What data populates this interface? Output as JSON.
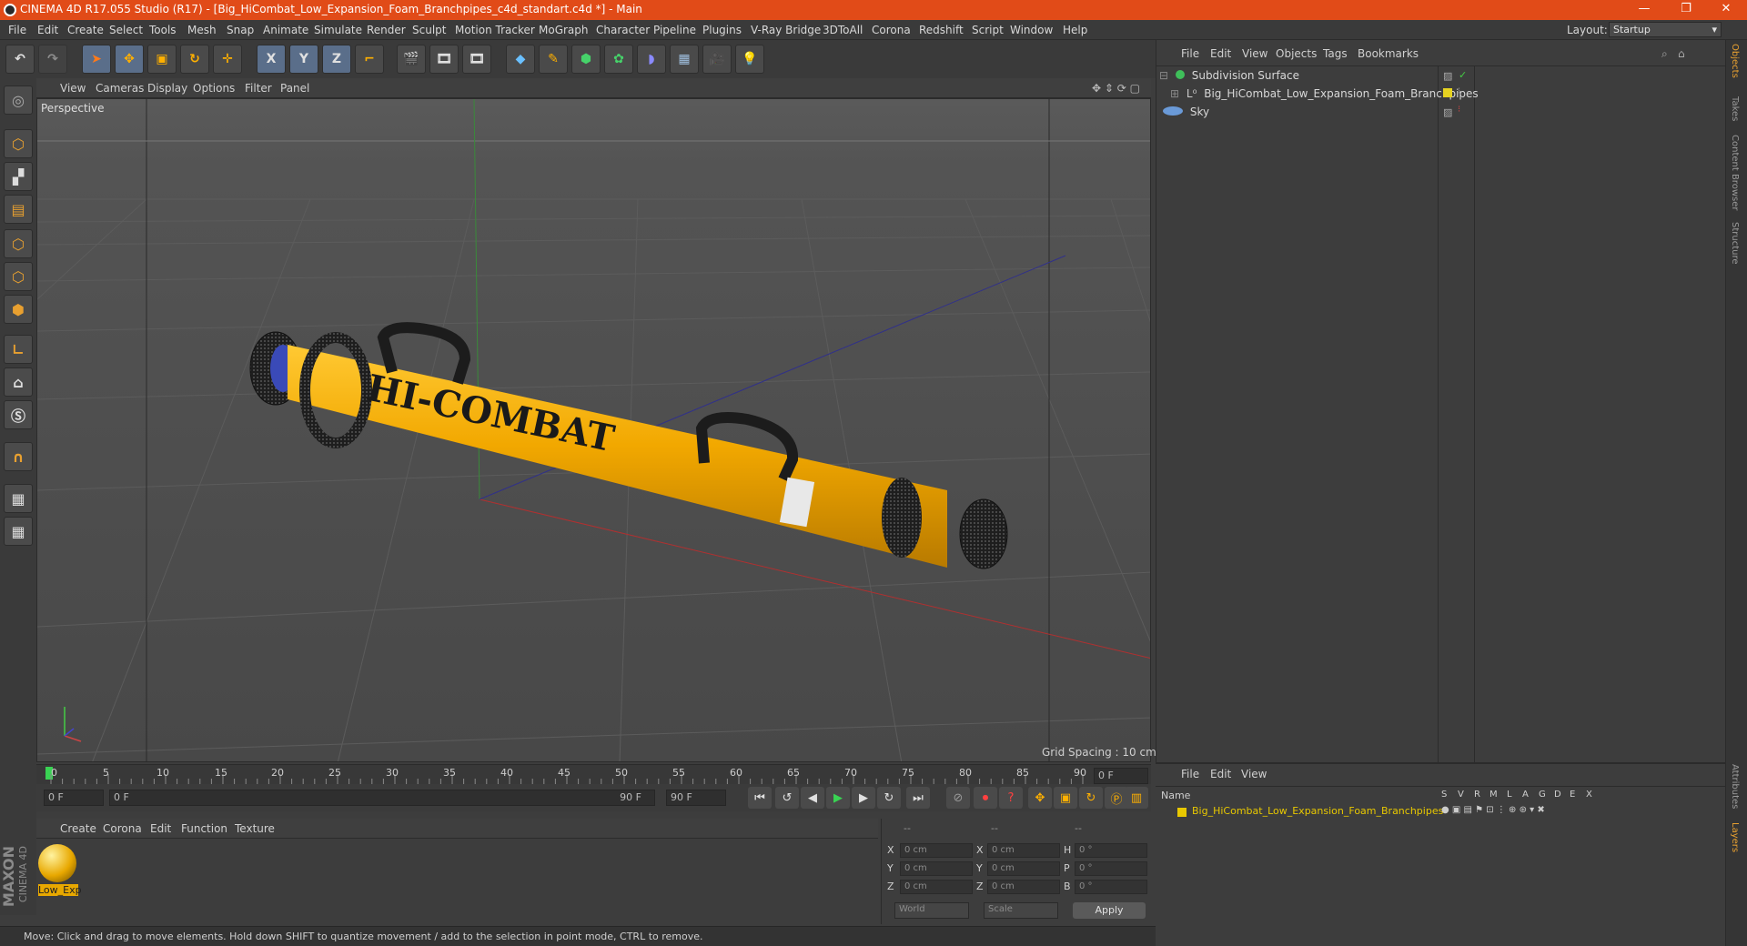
{
  "window": {
    "title": "CINEMA 4D R17.055 Studio (R17) - [Big_HiCombat_Low_Expansion_Foam_Branchpipes_c4d_standart.c4d *] - Main",
    "minimize": "—",
    "restore": "❐",
    "close": "✕"
  },
  "menu": [
    "File",
    "Edit",
    "Create",
    "Select",
    "Tools",
    "Mesh",
    "Snap",
    "Animate",
    "Simulate",
    "Render",
    "Sculpt",
    "Motion Tracker",
    "MoGraph",
    "Character",
    "Pipeline",
    "Plugins",
    "V-Ray Bridge",
    "3DToAll",
    "Corona",
    "Redshift",
    "Script",
    "Window",
    "Help"
  ],
  "layout": {
    "label": "Layout:",
    "value": "Startup"
  },
  "toolbar": {
    "axis_x": "X",
    "axis_y": "Y",
    "axis_z": "Z"
  },
  "viewport": {
    "menu": [
      "View",
      "Cameras",
      "Display",
      "Options",
      "Filter",
      "Panel"
    ],
    "camera_label": "Perspective",
    "grid_spacing": "Grid Spacing : 10 cm",
    "model_text": "HI-COMBAT"
  },
  "timeline": {
    "ticks": [
      "0",
      "5",
      "10",
      "15",
      "20",
      "25",
      "30",
      "35",
      "40",
      "45",
      "50",
      "55",
      "60",
      "65",
      "70",
      "75",
      "80",
      "85",
      "90"
    ],
    "current_frame": "0 F",
    "start_frame": "0 F",
    "range_start": "0 F",
    "range_end": "90 F",
    "end_frame": "90 F"
  },
  "material_manager": {
    "menu": [
      "Create",
      "Corona",
      "Edit",
      "Function",
      "Texture"
    ],
    "material_label": "Low_Exp"
  },
  "coordinates": {
    "headers": [
      "--",
      "--",
      "--"
    ],
    "rows": [
      {
        "l1": "X",
        "v1": "0 cm",
        "l2": "X",
        "v2": "0 cm",
        "l3": "H",
        "v3": "0 °"
      },
      {
        "l1": "Y",
        "v1": "0 cm",
        "l2": "Y",
        "v2": "0 cm",
        "l3": "P",
        "v3": "0 °"
      },
      {
        "l1": "Z",
        "v1": "0 cm",
        "l2": "Z",
        "v2": "0 cm",
        "l3": "B",
        "v3": "0 °"
      }
    ],
    "world": "World",
    "scale": "Scale",
    "apply": "Apply"
  },
  "status": "Move: Click and drag to move elements. Hold down SHIFT to quantize movement / add to the selection in point mode, CTRL to remove.",
  "maxon": {
    "brand": "MAXON",
    "product": "CINEMA 4D"
  },
  "objects": {
    "menu": [
      "File",
      "Edit",
      "View",
      "Objects",
      "Tags",
      "Bookmarks"
    ],
    "items": [
      {
        "name": "Subdivision Surface",
        "color": "#3fbf5a"
      },
      {
        "name": "Big_HiCombat_Low_Expansion_Foam_Branchpipes",
        "color": "#e6d321"
      },
      {
        "name": "Sky",
        "color": "#6a9ad8"
      }
    ]
  },
  "layers": {
    "menu": [
      "File",
      "Edit",
      "View"
    ],
    "header_name": "Name",
    "columns": [
      "S",
      "V",
      "R",
      "M",
      "L",
      "A",
      "G",
      "D",
      "E",
      "X"
    ],
    "item": "Big_HiCombat_Low_Expansion_Foam_Branchpipes",
    "item_color": "#e8c800"
  },
  "right_tabs": [
    "Objects",
    "Takes",
    "Content Browser",
    "Structure",
    "Attributes",
    "Layers"
  ]
}
